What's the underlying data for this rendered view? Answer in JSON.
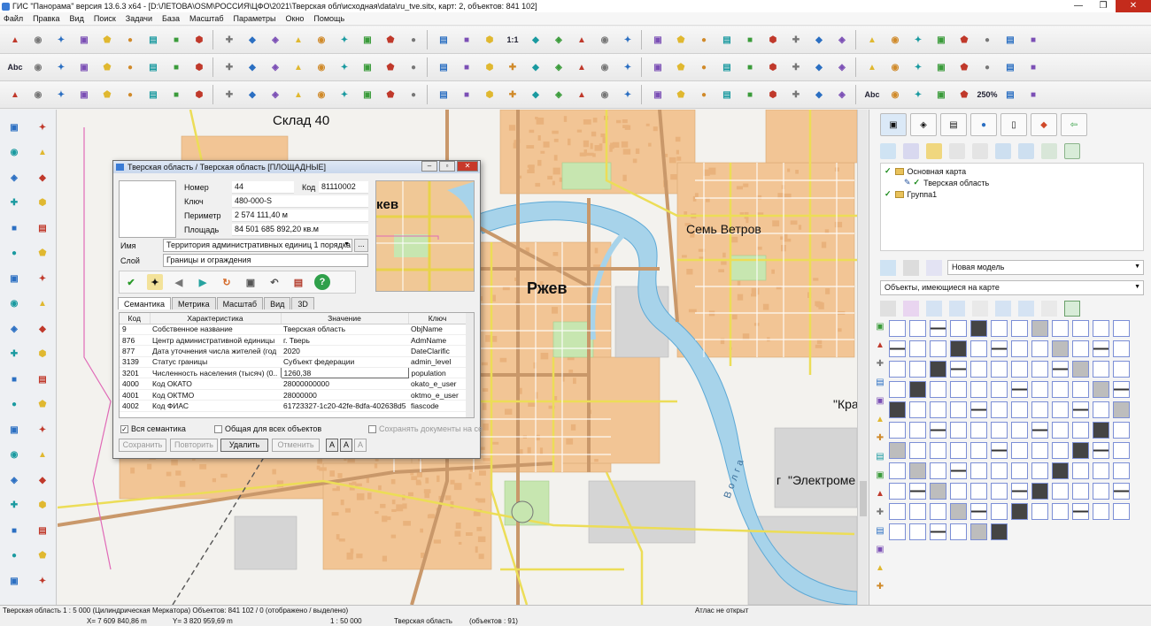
{
  "window": {
    "title": "ГИС \"Панорама\" версия 13.6.3 x64 - [D:\\ЛЕТОВА\\OSM\\РОССИЯ\\ЦФО\\2021\\Тверская обл\\исходная\\data\\ru_tve.sitx, карт: 2, объектов: 841 102]",
    "btn_minimize": "—",
    "btn_maximize": "❐",
    "btn_close": "✕"
  },
  "menu": [
    "Файл",
    "Правка",
    "Вид",
    "Поиск",
    "Задачи",
    "База",
    "Масштаб",
    "Параметры",
    "Окно",
    "Помощь"
  ],
  "toolbar_texts": {
    "one_to_one": "1:1",
    "abc": "Abc",
    "zoom250": "250%"
  },
  "map": {
    "labels": {
      "sklad": "Склад  40",
      "rzhev": "Ржев",
      "sem_vetrov": "Семь  Ветров",
      "kra": "\"Кра",
      "elektrome": "\"Электроме",
      "kev": "кев",
      "volga": "Волга",
      "g": "г"
    }
  },
  "dialog": {
    "title": "Тверская область / Тверская область [ПЛОЩАДНЫЕ]",
    "nomer_label": "Номер",
    "nomer_value": "44",
    "kod_label": "Код",
    "kod_value": "81110002",
    "kluch_label": "Ключ",
    "kluch_value": "480-000-S",
    "perimetr_label": "Периметр",
    "perimetr_value": "2 574 111,40 м",
    "ploshad_label": "Площадь",
    "ploshad_value": "84 501 685 892,20 кв.м",
    "imya_label": "Имя",
    "imya_value": "Территория административных единиц 1 порядка",
    "sloi_label": "Слой",
    "sloi_value": "Границы и ограждения",
    "browse_btn": "...",
    "tabs": [
      "Семантика",
      "Метрика",
      "Масштаб",
      "Вид",
      "3D"
    ],
    "grid_headers": [
      "Код",
      "Характеристика",
      "Значение",
      "Ключ"
    ],
    "grid_rows": [
      {
        "code": "9",
        "name": "Собственное название",
        "value": "Тверская область",
        "key": "ObjName"
      },
      {
        "code": "876",
        "name": "Центр административной единицы",
        "value": "г. Тверь",
        "key": "AdmName"
      },
      {
        "code": "877",
        "name": "Дата уточнения числа жителей (год",
        "value": "2020",
        "key": "DateClarific"
      },
      {
        "code": "3139",
        "name": "Статус границы",
        "value": "Субъект федерации",
        "key": "admin_level"
      },
      {
        "code": "3201",
        "name": "Численность населения (тысяч)",
        "unit": "(0..",
        "value": "1260,38",
        "key": "population"
      },
      {
        "code": "4000",
        "name": "Код ОКАТО",
        "value": "28000000000",
        "key": "okato_e_user"
      },
      {
        "code": "4001",
        "name": "Код ОКТМО",
        "value": "28000000",
        "key": "oktmo_e_user"
      },
      {
        "code": "4002",
        "name": "Код ФИАС",
        "value": "61723327-1c20-42fe-8dfa-402638d5",
        "key": "fiascode"
      }
    ],
    "cb_all_semantics": "Вся семантика",
    "cb_common": "Общая для всех объектов",
    "cb_save_docs": "Сохранять документы на се",
    "btn_save": "Сохранить",
    "btn_repeat": "Повторить",
    "btn_delete": "Удалить",
    "btn_cancel": "Отменить",
    "btn_a1": "A",
    "btn_a2": "A",
    "btn_a3": "A"
  },
  "right_panel": {
    "tree": [
      {
        "label": "Основная карта",
        "indent": 0
      },
      {
        "label": "Тверская область",
        "indent": 1
      },
      {
        "label": "Группа1",
        "indent": 0
      }
    ],
    "model_select": "Новая модель",
    "objects_select": "Объекты, имеющиеся на карте"
  },
  "status": {
    "left": "Тверская область  1 : 5 000 (Цилиндрическая Меркатора) Объектов: 841 102 / 0 (отображено / выделено)",
    "atlas": "Атлас не открыт",
    "coords_x": "X= 7 609 840,86 m",
    "coords_y": "Y= 3 820 959,69 m",
    "scale": "1 : 50 000",
    "layer": "Тверская область",
    "objects": "(объектов : 91)"
  },
  "colors": {
    "blocks": "#f2c595",
    "river": "#a7d3ea",
    "roads_main": "#c9986a",
    "roads_yellow": "#ecdd57",
    "parks": "#c7e6b0",
    "toolbar_green": "#3a9b3a"
  }
}
